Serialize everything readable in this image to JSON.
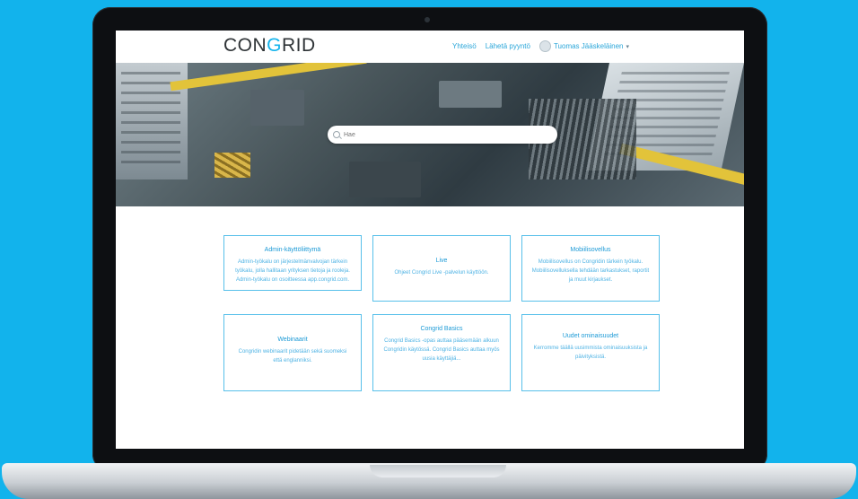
{
  "header": {
    "logo": {
      "left": "CON",
      "right": "RID",
      "mark": "G"
    },
    "nav": {
      "home": "Yhteisö",
      "open_ticket": "Lähetä pyyntö",
      "user_name": "Tuomas Jääskeläinen"
    }
  },
  "hero": {
    "search": {
      "placeholder": "Hae"
    }
  },
  "cards": [
    {
      "title": "Admin-käyttöliittymä",
      "body": "Admin-työkalu on järjestelmänvalvojan tärkein työkalu, jolla hallitaan yrityksen tietoja ja rooleja. Admin-työkalu on osoitteessa app.congrid.com."
    },
    {
      "title": "Live",
      "body": "Ohjeet Congrid Live -palvelun käyttöön."
    },
    {
      "title": "Mobiilisovellus",
      "body": "Mobiilisovellus on Congridin tärkein työkalu. Mobiilisovelluksella tehdään tarkastukset, raportit ja muut kirjaukset."
    },
    {
      "title": "Webinaarit",
      "body": "Congridin webinaarit pidetään sekä suomeksi että englanniksi."
    },
    {
      "title": "Congrid Basics",
      "body": "Congrid Basics -opas auttaa pääsemään alkuun Congridin käytössä. Congrid Basics auttaa myös uusia käyttäjiä..."
    },
    {
      "title": "Uudet ominaisuudet",
      "body": "Kerromme täällä uusimmista ominaisuuksista ja päivityksistä."
    }
  ],
  "colors": {
    "accent": "#12b3ec",
    "card_border": "#58c0ea"
  }
}
